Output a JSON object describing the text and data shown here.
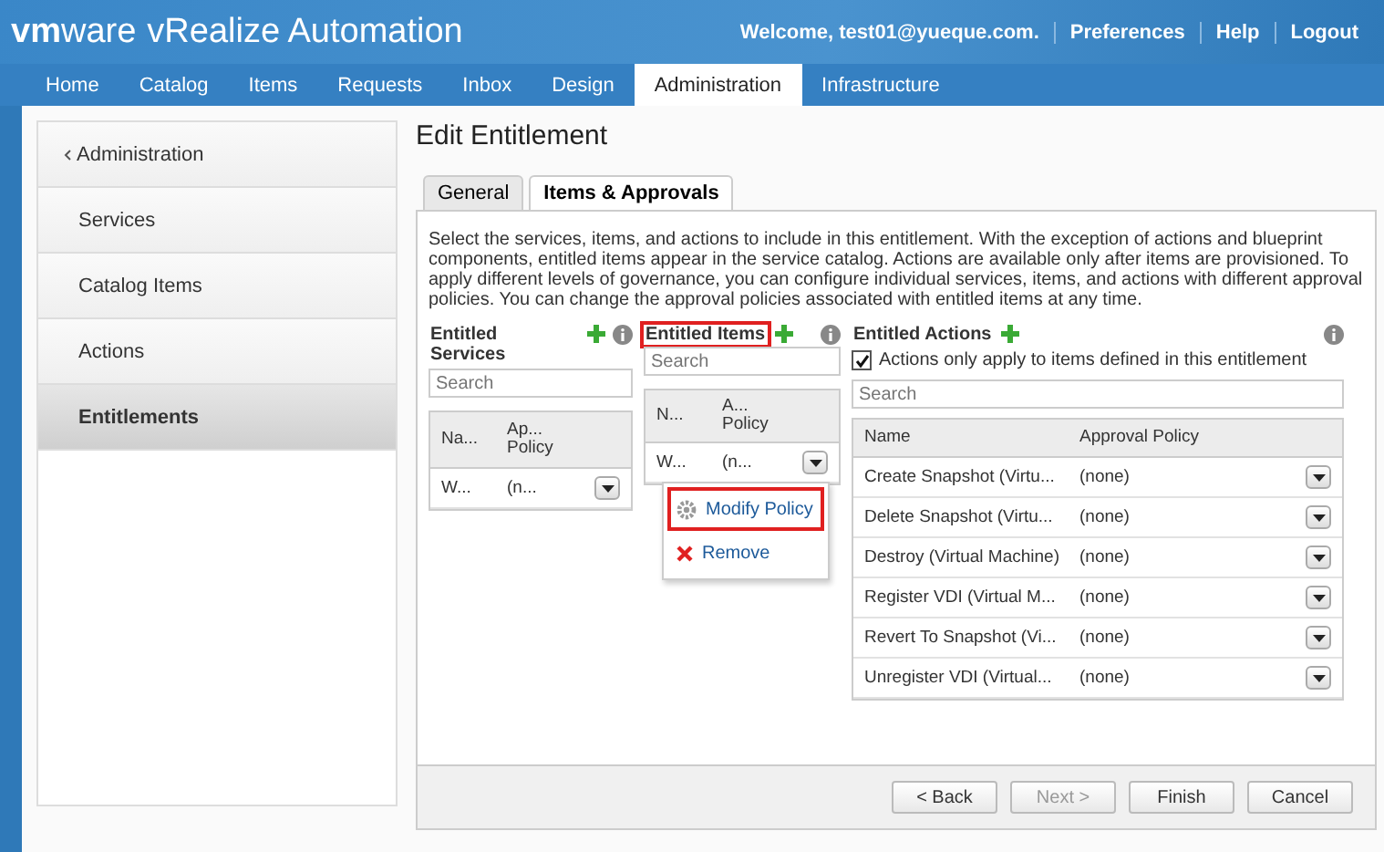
{
  "header": {
    "logo": "**vm**ware",
    "product": "vRealize Automation",
    "links": [
      "Welcome, test01@yueque.com.",
      "Preferences",
      "Help",
      "Logout"
    ]
  },
  "nav": [
    {
      "label": "Home",
      "selected": false
    },
    {
      "label": "Catalog",
      "selected": false
    },
    {
      "label": "Items",
      "selected": false
    },
    {
      "label": "Requests",
      "selected": false
    },
    {
      "label": "Inbox",
      "selected": false
    },
    {
      "label": "Design",
      "selected": false
    },
    {
      "label": "Administration",
      "selected": true
    },
    {
      "label": "Infrastructure",
      "selected": false
    }
  ],
  "sidebar": {
    "back": "Administration",
    "items": [
      {
        "label": "Services",
        "selected": false
      },
      {
        "label": "Catalog Items",
        "selected": false
      },
      {
        "label": "Actions",
        "selected": false
      },
      {
        "label": "Entitlements",
        "selected": true
      }
    ]
  },
  "title": "Edit Entitlement",
  "tabs": [
    {
      "label": "General",
      "selected": false
    },
    {
      "label": "Items & Approvals",
      "selected": true
    }
  ],
  "description": "Select the services, items, and actions to include in this entitlement. With the exception of actions and blueprint components, entitled items appear in the service catalog. Actions are available only after items are provisioned. To apply different levels of governance, you can configure individual services, items, and actions with different approval policies. You can change the approval policies associated with entitled items at any time.",
  "services": {
    "title": "Entitled Services",
    "highlighted": false,
    "search": {
      "placeholder": "Search"
    },
    "columns": [
      "Na...",
      "Ap... Policy"
    ],
    "rows": [
      [
        "W...",
        "(n..."
      ]
    ]
  },
  "items": {
    "title": "Entitled Items",
    "highlighted": true,
    "search": {
      "placeholder": "Search"
    },
    "columns": [
      "N...",
      "A... Policy"
    ],
    "rows": [
      [
        "W...",
        "(n..."
      ]
    ]
  },
  "menu": [
    {
      "label": "Modify Policy",
      "kind": "gear",
      "highlighted": true
    },
    {
      "label": "Remove",
      "kind": "remove",
      "highlighted": false
    }
  ],
  "actions": {
    "title": "Entitled Actions",
    "checkbox": {
      "label": "Actions only apply to items defined in this entitlement",
      "checked": true
    },
    "search": {
      "placeholder": "Search"
    },
    "columns": [
      "Name",
      "Approval Policy"
    ],
    "rows": [
      [
        "Create Snapshot (Virtu...",
        "(none)"
      ],
      [
        "Delete Snapshot (Virtu...",
        "(none)"
      ],
      [
        "Destroy (Virtual Machine)",
        "(none)"
      ],
      [
        "Register VDI (Virtual M...",
        "(none)"
      ],
      [
        "Revert To Snapshot (Vi...",
        "(none)"
      ],
      [
        "Unregister VDI (Virtual...",
        "(none)"
      ]
    ]
  },
  "buttons": [
    {
      "label": "< Back",
      "disabled": false
    },
    {
      "label": "Next >",
      "disabled": true
    },
    {
      "label": "Finish",
      "disabled": false
    },
    {
      "label": "Cancel",
      "disabled": false
    }
  ]
}
